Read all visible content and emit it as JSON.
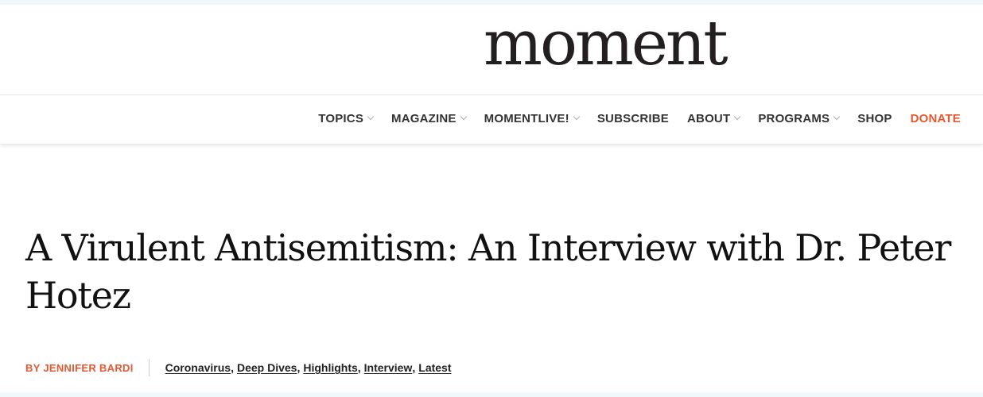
{
  "brand": {
    "logo_text": "moment"
  },
  "nav": {
    "items": [
      {
        "label": "TOPICS",
        "has_dropdown": true
      },
      {
        "label": "MAGAZINE",
        "has_dropdown": true
      },
      {
        "label": "MOMENTLIVE!",
        "has_dropdown": true
      },
      {
        "label": "SUBSCRIBE",
        "has_dropdown": false
      },
      {
        "label": "ABOUT",
        "has_dropdown": true
      },
      {
        "label": "PROGRAMS",
        "has_dropdown": true
      },
      {
        "label": "SHOP",
        "has_dropdown": false
      },
      {
        "label": "DONATE",
        "has_dropdown": false,
        "accent": true
      }
    ]
  },
  "article": {
    "title": "A Virulent Antisemitism: An Interview with Dr. Peter Hotez",
    "byline": "BY JENNIFER BARDI",
    "categories": [
      "Coronavirus",
      "Deep Dives",
      "Highlights",
      "Interview",
      "Latest"
    ],
    "category_separator": ","
  },
  "colors": {
    "accent": "#e9572f",
    "text": "#231f20",
    "background_outer": "#f1f8fb"
  }
}
